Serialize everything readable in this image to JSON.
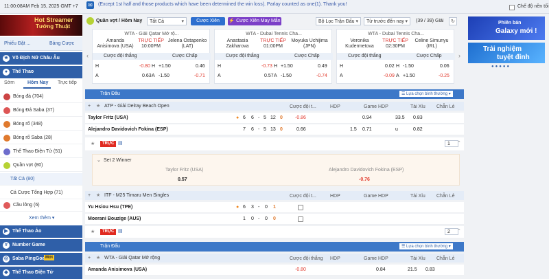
{
  "topbar": {
    "clock": "11:00:08AM Feb 15, 2025 GMT +7",
    "notice": "(Except 1st half and those products which have been determined the win loss). Parlay counted as one(1). Thank you!",
    "lite_mode": "Chế độ nền tối"
  },
  "sidebar": {
    "promo": [
      "Hot Streamer",
      "Tướng Thuật"
    ],
    "tabs": [
      "Phiếu Đặt ...",
      "Bảng Cược"
    ],
    "sections": [
      {
        "label": "Vô Địch Nữ Châu Âu"
      },
      {
        "label": "Thể Thao"
      }
    ],
    "subtabs": [
      "Sớm",
      "Hôm Nay",
      "Trực tiếp"
    ],
    "items": [
      {
        "label": "Bóng đá",
        "count": "(704)"
      },
      {
        "label": "Bóng Đá Saba",
        "count": "(37)"
      },
      {
        "label": "Bóng rổ",
        "count": "(348)"
      },
      {
        "label": "Bóng rổ Saba",
        "count": "(28)"
      },
      {
        "label": "Thể Thao Điện Tử",
        "count": "(51)"
      },
      {
        "label": "Quần vợt",
        "count": "(80)"
      },
      {
        "label": "Tất Cả",
        "count": "(80)"
      },
      {
        "label": "Cá Cược Tổng Hợp",
        "count": "(71)"
      },
      {
        "label": "Cầu lông",
        "count": "(6)"
      }
    ],
    "see_more": "Xem thêm",
    "bottom": [
      {
        "label": "Thể Thao Ảo"
      },
      {
        "label": "Number Game"
      },
      {
        "label": "Saba PingGoal",
        "badge": "Mới"
      },
      {
        "label": "Thể Thao Điện Tử"
      }
    ]
  },
  "filters": {
    "sport": "Quần vợt / Hôm Nay",
    "all": "Tất Cả",
    "parlay": "Cược Xiên",
    "lucky": "Cược Xiên May Mắn",
    "league_filter": "Bộ Lọc Trận Đấu",
    "sort": "Từ trước đến nay",
    "count": "(39 / 39) Giải"
  },
  "cards": [
    {
      "title": "WTA - Giải Qatar Mở rộ...",
      "p1": "Amanda Anisimova (USA)",
      "status": "TRỰC TIẾP",
      "time": "10:00PM",
      "p2": "Jelena Ostapenko (LAT)",
      "ml_label": "Cược đội thắng",
      "hc_label": "Cược Chấp",
      "rows": [
        {
          "side": "H",
          "ml": "-0.80",
          "hc": "+1.50",
          "hcv": "0.46"
        },
        {
          "side": "A",
          "ml": "0.63",
          "hc": "-1.50",
          "hcv": "-0.71"
        }
      ]
    },
    {
      "title": "WTA - Dubai Tennis Cha...",
      "p1": "Anastasia Zakharova",
      "status": "TRỰC TIẾP",
      "time": "01:00PM",
      "p2": "Moyuka Uchijima (JPN)",
      "ml_label": "Cược đội thắng",
      "hc_label": "Cược Chấp",
      "rows": [
        {
          "side": "H",
          "ml": "-0.73",
          "hc": "+1.50",
          "hcv": "0.49"
        },
        {
          "side": "A",
          "ml": "0.57",
          "hc": "-1.50",
          "hcv": "-0.74"
        }
      ]
    },
    {
      "title": "WTA - Dubai Tennis Cha...",
      "p1": "Veronika Kudermetova",
      "status": "TRỰC TIẾP",
      "time": "02:30PM",
      "p2": "Celine Simunyu (IRL)",
      "ml_label": "Cược đội thắng",
      "hc_label": "Cược Chấp",
      "rows": [
        {
          "side": "H",
          "ml": "0.02",
          "hc": "-1.50",
          "hcv": "0.06"
        },
        {
          "side": "A",
          "ml": "-0.09",
          "hc": "+1.50",
          "hcv": "-0.25"
        }
      ]
    }
  ],
  "right_promo": {
    "b1": [
      "Phiên bản",
      "Galaxy mới !"
    ],
    "b2": [
      "Trải nghiệm",
      "tuyệt đỉnh"
    ]
  },
  "section1": {
    "title": "Trận Đấu",
    "view": "Lựa chọn bình thường",
    "league": "ATP - Giải Delray Beach Open",
    "cols": [
      "Cược đội t...",
      "HDP",
      "Game HDP",
      "Tài Xỉu",
      "Chẵn Lẻ"
    ],
    "rows": [
      {
        "name": "Taylor Fritz (USA)",
        "s1": "6",
        "s2": "6",
        "s3": "5",
        "g": "12",
        "pts": "0",
        "ml": "-0.86",
        "ghdp_line": "",
        "ghdp": "0.94",
        "ou_line": "33.5",
        "ou": "0.83"
      },
      {
        "name": "Alejandro Davidovich Fokina (ESP)",
        "s1": "7",
        "s2": "6",
        "s3": "5",
        "g": "13",
        "pts": "0",
        "ml": "0.66",
        "ghdp_line": "1.5",
        "ghdp": "0.71",
        "ou_line": "u",
        "ou": "0.82"
      }
    ],
    "live": "TRỰC",
    "page": "1",
    "set_market": "Set 2 Winner",
    "set_p1": "Taylor Fritz (USA)",
    "set_p2": "Alejandro Davidovich Fokina (ESP)",
    "set_v1": "0.57",
    "set_v2": "-0.76"
  },
  "section2": {
    "league": "ITF - M25 Timaru Men Singles",
    "cols": [
      "Cược đội t...",
      "HDP",
      "Game HDP",
      "Tài Xỉu",
      "Chẵn Lẻ"
    ],
    "rows": [
      {
        "name": "Yu Hsiou Hsu (TPE)",
        "s1": "6",
        "s2": "3",
        "g": "0",
        "pts": "1"
      },
      {
        "name": "Moerani Bouzige (AUS)",
        "s1": "1",
        "s2": "0",
        "g": "0",
        "pts": "0"
      }
    ],
    "live": "TRỰC",
    "page": "2"
  },
  "section3": {
    "title": "Trận Đấu",
    "view": "Lựa chọn bình thường",
    "league": "WTA - Giải Qatar Mở rộng",
    "cols": [
      "Cược đội thắng",
      "HDP",
      "Game HDP",
      "Tài Xỉu",
      "Chẵn Lẻ"
    ],
    "rows": [
      {
        "name": "Amanda Anisimova (USA)",
        "ml": "-0.80",
        "ghdp": "0.84",
        "ou_line": "21.5",
        "ou": "0.83"
      }
    ]
  },
  "colors": {
    "accent": "#2f5fa8",
    "live": "#e02a20",
    "negative": "#e23b2e"
  }
}
